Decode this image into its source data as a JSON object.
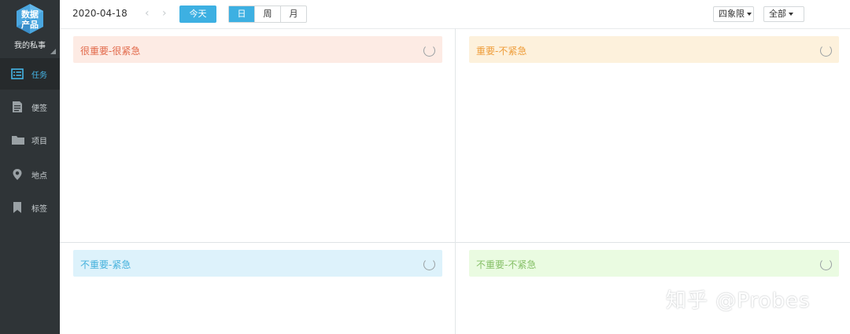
{
  "sidebar": {
    "logo_line1": "数据",
    "logo_line2": "产品",
    "user_name": "我的私事",
    "items": [
      {
        "label": "任务",
        "icon": "list-icon",
        "active": true
      },
      {
        "label": "便签",
        "icon": "note-icon"
      },
      {
        "label": "项目",
        "icon": "folder-icon"
      },
      {
        "label": "地点",
        "icon": "location-pin-icon"
      },
      {
        "label": "标签",
        "icon": "bookmark-icon"
      }
    ]
  },
  "toolbar": {
    "date": "2020-04-18",
    "prev_icon": "‹",
    "next_icon": "›",
    "today_label": "今天",
    "view_day": "日",
    "view_week": "周",
    "view_month": "月",
    "view_selected": "日",
    "quadrant_dropdown": "四象限",
    "filter_dropdown": "全部"
  },
  "quadrants": [
    {
      "title": "很重要-很紧急",
      "bg": "#fdebe4",
      "color": "#e2694a"
    },
    {
      "title": "重要-不紧急",
      "bg": "#fdf1dc",
      "color": "#ee9d3a"
    },
    {
      "title": "不重要-紧急",
      "bg": "#ddf2fb",
      "color": "#45b1dc"
    },
    {
      "title": "不重要-不紧急",
      "bg": "#eafbe1",
      "color": "#86c067"
    }
  ],
  "watermark": "知乎 @Probes",
  "colors": {
    "accent": "#3db0e2",
    "sidebar_bg": "#2f3437"
  }
}
